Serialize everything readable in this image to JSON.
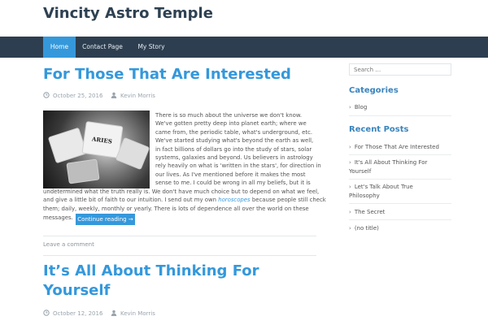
{
  "site": {
    "title": "Vincity Astro Temple"
  },
  "nav": {
    "items": [
      {
        "label": "Home"
      },
      {
        "label": "Contact Page"
      },
      {
        "label": "My Story"
      }
    ]
  },
  "posts": [
    {
      "title": "For Those That Are Interested",
      "date": "October 25, 2016",
      "author": "Kevin Morris",
      "image_alt": "ARIES",
      "excerpt_lines": [
        "There is so much about the universe we don't know.",
        "We've gotten pretty deep into planet earth; where we",
        "came from, the periodic table, what's underground, etc.",
        "We've started studying what's beyond the earth as well,",
        "in fact billions of dollars go into the study of stars, solar",
        "systems, galaxies and beyond. Us believers in astrology",
        "rely heavily on what is 'written in the stars', for direction in",
        "our lives. As I've mentioned before it makes the most",
        "sense to me. I could be wrong in all my beliefs, but it is"
      ],
      "excerpt_full_lines": [
        "undetermined what the truth really is. We don't have much choice but to depend on what we feel,",
        "and give a little bit of faith to our intuition. I send out my own"
      ],
      "link_word": "horoscopes",
      "after_link": " because people still check",
      "line_after": "them; daily, weekly, monthly or yearly. There is lots of dependence all over the world on these",
      "last_line": "messages.",
      "continue_label": "Continue reading →",
      "comment_label": "Leave a comment"
    },
    {
      "title_line1": "It’s All About Thinking For",
      "title_line2": "Yourself",
      "date": "October 12, 2016",
      "author": "Kevin Morris"
    }
  ],
  "sidebar": {
    "search_placeholder": "Search …",
    "categories_title": "Categories",
    "categories": [
      {
        "label": "Blog"
      }
    ],
    "recent_title": "Recent Posts",
    "recent": [
      {
        "line1": "For Those That Are Interested",
        "line2": ""
      },
      {
        "line1": "It's All About Thinking For",
        "line2": "Yourself"
      },
      {
        "line1": "Let's Talk About True",
        "line2": "Philosophy"
      },
      {
        "line1": "The Secret",
        "line2": ""
      },
      {
        "line1": "(no title)",
        "line2": ""
      }
    ]
  },
  "colors": {
    "accent": "#3598db",
    "nav_bg": "#2d3e50",
    "title": "#2e4152"
  }
}
